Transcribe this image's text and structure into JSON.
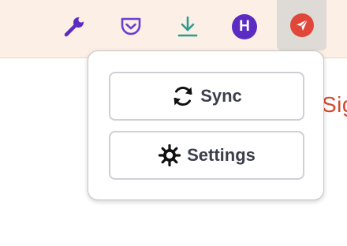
{
  "toolbar": {
    "icons": [
      {
        "name": "wrench-icon",
        "color": "#5b2bc2"
      },
      {
        "name": "pocket-icon",
        "color": "#6a3fd1"
      },
      {
        "name": "download-icon",
        "color": "#2a9d8f"
      },
      {
        "name": "profile-avatar",
        "initial": "H",
        "color": "#5b2bc2"
      },
      {
        "name": "send-icon",
        "color": "#e0463a",
        "active": true
      }
    ],
    "avatar_initial": "H"
  },
  "page": {
    "partial_text": "Sig"
  },
  "popup": {
    "sync_label": "Sync",
    "sync_icon": "sync-icon",
    "settings_label": "Settings",
    "settings_icon": "gear-icon"
  },
  "colors": {
    "toolbar_bg": "#fcefe6",
    "accent_purple": "#5b2bc2",
    "accent_red": "#e0463a",
    "page_text_red": "#d9472f"
  }
}
